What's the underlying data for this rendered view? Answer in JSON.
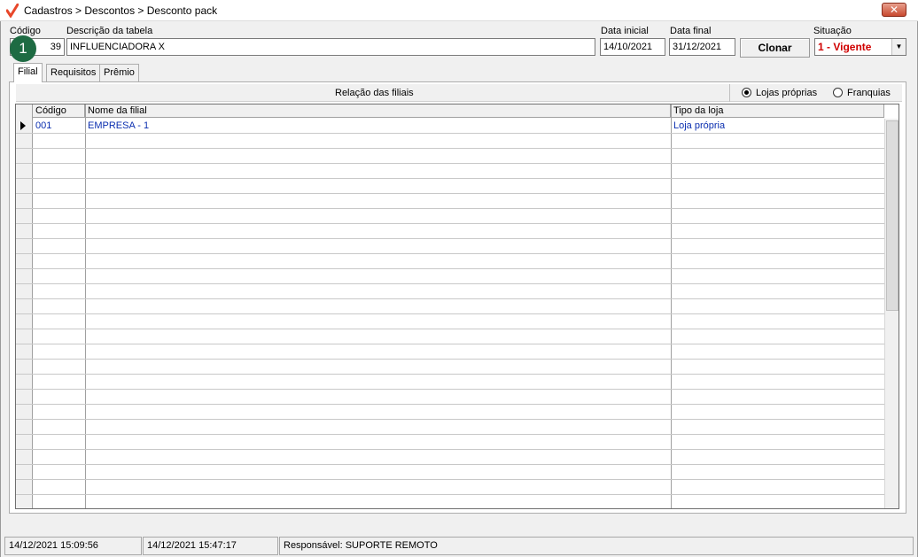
{
  "window": {
    "title": "Cadastros > Descontos > Desconto pack",
    "close_label": "✕"
  },
  "form": {
    "codigo_label": "Código",
    "codigo_value": "39",
    "descricao_label": "Descrição da tabela",
    "descricao_value": "INFLUENCIADORA X",
    "data_inicial_label": "Data inicial",
    "data_inicial_value": "14/10/2021",
    "data_final_label": "Data final",
    "data_final_value": "31/12/2021",
    "clonar_label": "Clonar",
    "situacao_label": "Situação",
    "situacao_value": "1 - Vigente",
    "badge": "1"
  },
  "tabs": [
    {
      "label": "Filial",
      "active": true
    },
    {
      "label": "Requisitos",
      "active": false
    },
    {
      "label": "Prêmio",
      "active": false
    }
  ],
  "panel": {
    "title": "Relação das filiais",
    "radio_options": [
      {
        "label": "Lojas próprias",
        "selected": true
      },
      {
        "label": "Franquias",
        "selected": false
      }
    ]
  },
  "grid": {
    "columns": [
      "Código",
      "Nome da filial",
      "Tipo da loja"
    ],
    "rows": [
      {
        "codigo": "001",
        "nome": "EMPRESA - 1",
        "tipo": "Loja própria"
      }
    ]
  },
  "statusbar": {
    "created": "14/12/2021 15:09:56",
    "modified": "14/12/2021 15:47:17",
    "responsavel": "Responsável: SUPORTE REMOTO"
  },
  "colors": {
    "accent_check": "#e8472a",
    "situacao_text": "#d00000",
    "grid_text": "#0b2fb0",
    "badge": "#1e6b43"
  }
}
